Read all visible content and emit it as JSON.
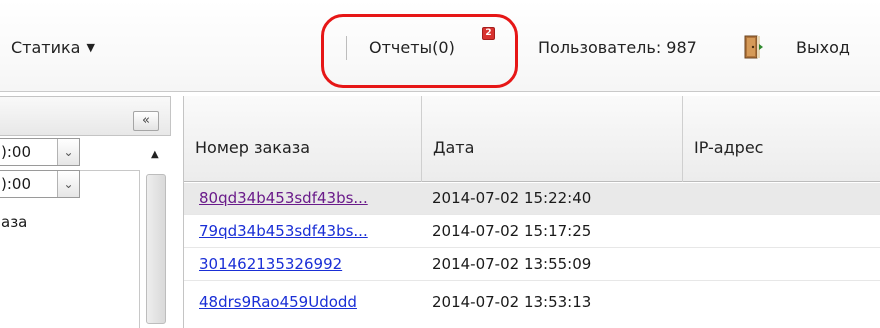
{
  "toolbar": {
    "statika_label": "Статика",
    "statika_arrow": "▼",
    "reports_label": "Отчеты(0)",
    "reports_badge": "2",
    "user_label": "Пользователь: 987",
    "exit_label": "Выход"
  },
  "left_panel": {
    "collapse_glyph": "«",
    "scroll_up_glyph": "▲",
    "time_fields": [
      {
        "value": "):00",
        "dropdown_glyph": "⌄"
      },
      {
        "value": "):00",
        "dropdown_glyph": "⌄"
      }
    ],
    "order_label": "аза"
  },
  "grid": {
    "columns": [
      "Номер заказа",
      "Дата",
      "IP-адрес"
    ],
    "rows": [
      {
        "order": "80qd34b453sdf43bs...",
        "date": "2014-07-02 15:22:40",
        "ip": "",
        "selected": true,
        "visited": true
      },
      {
        "order": "79qd34b453sdf43bs...",
        "date": "2014-07-02 15:17:25",
        "ip": "",
        "selected": false,
        "visited": false
      },
      {
        "order": "301462135326992",
        "date": "2014-07-02 13:55:09",
        "ip": "",
        "selected": false,
        "visited": false
      },
      {
        "order": "48drs9Rao459Udodd",
        "date": "2014-07-02 13:53:13",
        "ip": "",
        "selected": false,
        "visited": false
      }
    ]
  },
  "colors": {
    "highlight": "#e61616",
    "badge": "#d8322f",
    "link": "#1a2fd6",
    "visited_link": "#6a1b8a",
    "selected_row": "#e9e9e9"
  }
}
